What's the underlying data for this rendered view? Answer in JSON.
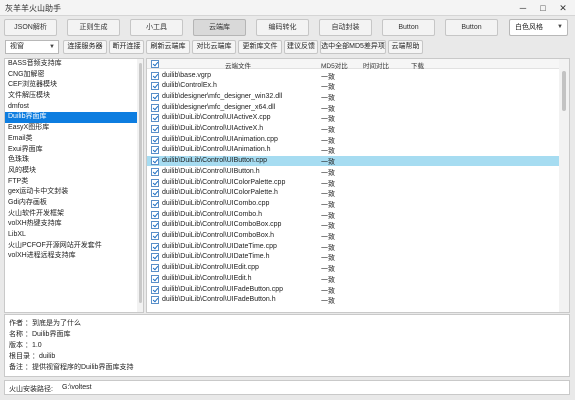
{
  "window": {
    "title": "灰羊羊火山助手",
    "minimize": "─",
    "maximize": "□",
    "close": "✕"
  },
  "tabs": [
    "JSON解析",
    "正则生成",
    "小工具",
    "云端库",
    "编码转化",
    "自动封装",
    "Button",
    "Button"
  ],
  "active_tab": 3,
  "theme_select": {
    "value": "白色风格",
    "icon": "chevron-down-icon"
  },
  "toolbar": {
    "view_select": "视窗",
    "buttons": [
      "连接服务器",
      "断开连接",
      "刷新云端库",
      "对比云端库",
      "更新库文件",
      "建议反馈",
      "选中全部MD5差异项",
      "云端帮助"
    ]
  },
  "library_list": {
    "items": [
      "BASS音频支持库",
      "CNG加解密",
      "CEF浏览器模块",
      "文件解压模块",
      "dmfost",
      "Duilib界面库",
      "EasyX图形库",
      "Email类",
      "Exui界面库",
      "色珠珠",
      "风的模块",
      "FTP类",
      "gex运动卡中文封装",
      "Gdi内存画板",
      "火山软件开发框架",
      "volXH热键支持库",
      "LibXL",
      "火山PCFOF开源网站开发套件",
      "volXH进程远程支持库"
    ],
    "selected_index": 5
  },
  "file_grid": {
    "columns": [
      "云端文件",
      "MD5对比",
      "时间对比",
      "下载"
    ],
    "rows": [
      {
        "file": "duilib\\base.vgrp",
        "md5": "一致"
      },
      {
        "file": "duilib\\ControlEx.h",
        "md5": "一致"
      },
      {
        "file": "duilib\\designer\\mfc_designer_win32.dll",
        "md5": "一致"
      },
      {
        "file": "duilib\\designer\\mfc_designer_x64.dll",
        "md5": "一致"
      },
      {
        "file": "duilib\\DuiLib\\Control\\UIActiveX.cpp",
        "md5": "一致"
      },
      {
        "file": "duilib\\DuiLib\\Control\\UIActiveX.h",
        "md5": "一致"
      },
      {
        "file": "duilib\\DuiLib\\Control\\UIAnimation.cpp",
        "md5": "一致"
      },
      {
        "file": "duilib\\DuiLib\\Control\\UIAnimation.h",
        "md5": "一致"
      },
      {
        "file": "duilib\\DuiLib\\Control\\UIButton.cpp",
        "md5": "一致"
      },
      {
        "file": "duilib\\DuiLib\\Control\\UIButton.h",
        "md5": "一致"
      },
      {
        "file": "duilib\\DuiLib\\Control\\UIColorPalette.cpp",
        "md5": "一致"
      },
      {
        "file": "duilib\\DuiLib\\Control\\UIColorPalette.h",
        "md5": "一致"
      },
      {
        "file": "duilib\\DuiLib\\Control\\UICombo.cpp",
        "md5": "一致"
      },
      {
        "file": "duilib\\DuiLib\\Control\\UICombo.h",
        "md5": "一致"
      },
      {
        "file": "duilib\\DuiLib\\Control\\UIComboBox.cpp",
        "md5": "一致"
      },
      {
        "file": "duilib\\DuiLib\\Control\\UIComboBox.h",
        "md5": "一致"
      },
      {
        "file": "duilib\\DuiLib\\Control\\UIDateTime.cpp",
        "md5": "一致"
      },
      {
        "file": "duilib\\DuiLib\\Control\\UIDateTime.h",
        "md5": "一致"
      },
      {
        "file": "duilib\\DuiLib\\Control\\UIEdit.cpp",
        "md5": "一致"
      },
      {
        "file": "duilib\\DuiLib\\Control\\UIEdit.h",
        "md5": "一致"
      },
      {
        "file": "duilib\\DuiLib\\Control\\UIFadeButton.cpp",
        "md5": "一致"
      },
      {
        "file": "duilib\\DuiLib\\Control\\UIFadeButton.h",
        "md5": "一致"
      }
    ],
    "selected_index": 8
  },
  "info": [
    "作者 ：到底是为了什么",
    "名称 ：Duilib界面库",
    "版本 ：1.0",
    "根目录 ：duilib",
    "备注 ：提供视窗程序的Duilib界面库支持"
  ],
  "install_path": {
    "label": "火山安装路径:",
    "value": "G:\\voltest"
  }
}
